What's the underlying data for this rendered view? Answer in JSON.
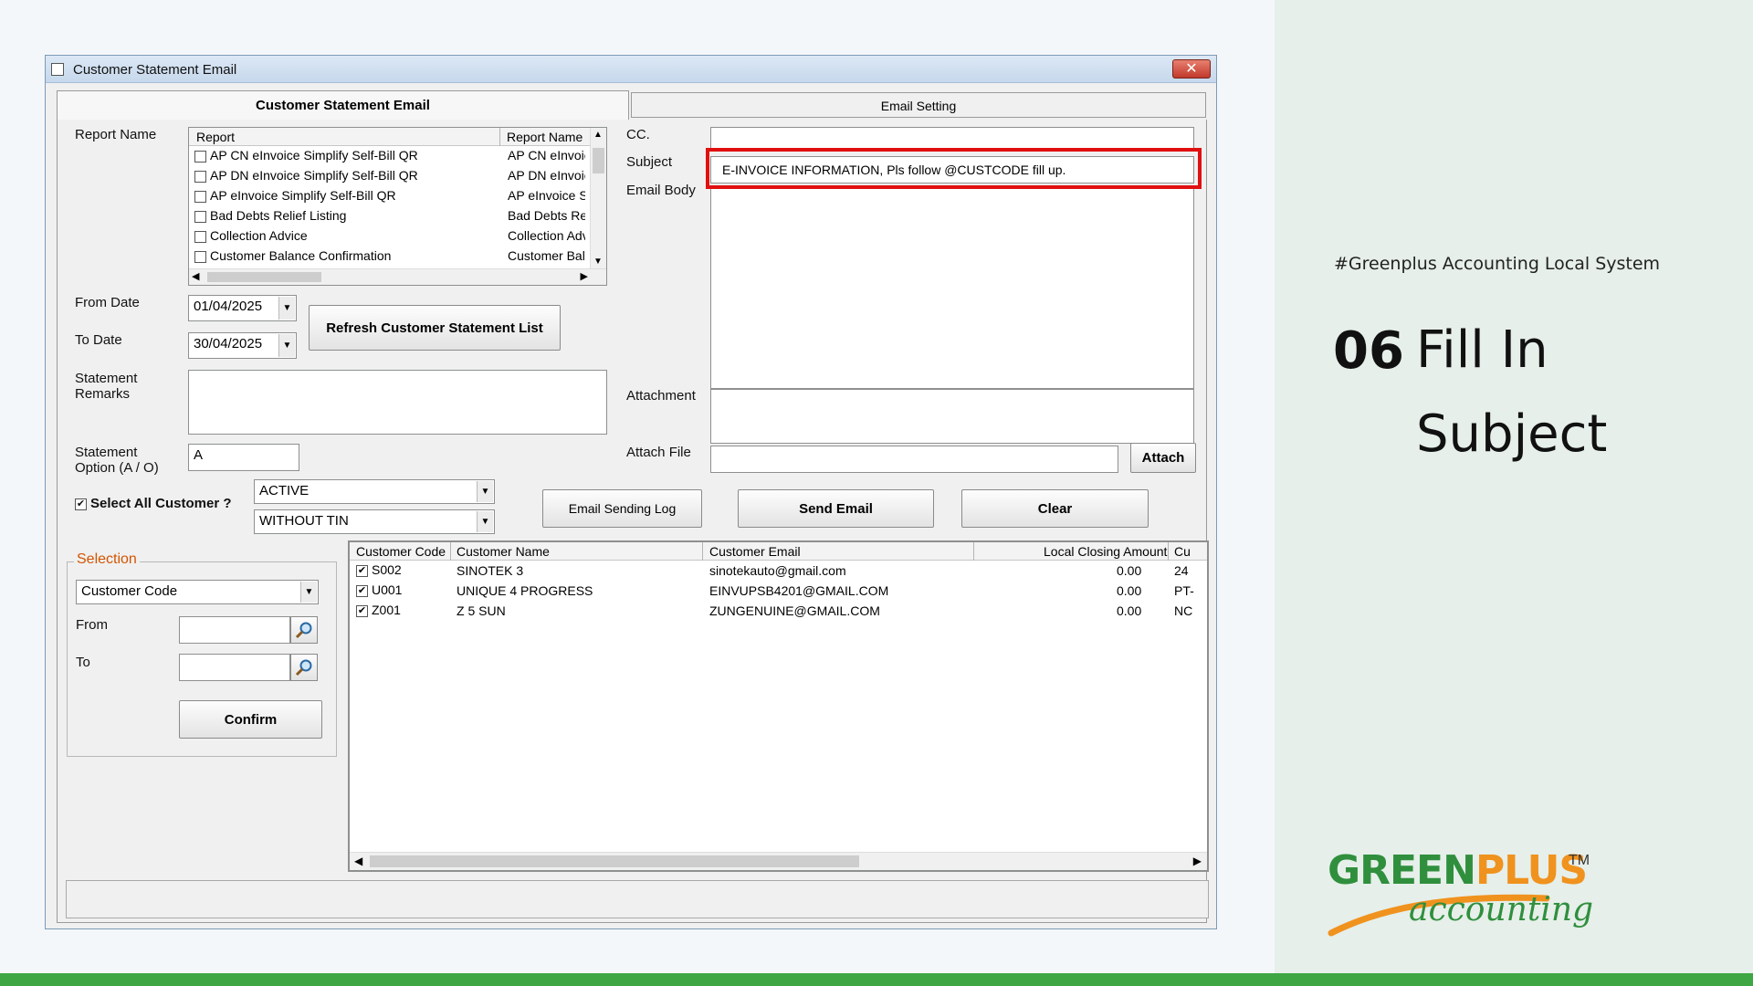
{
  "window": {
    "title": "Customer Statement Email",
    "close_label": "✕"
  },
  "tabs": {
    "active": "Customer Statement Email",
    "inactive": "Email Setting"
  },
  "left": {
    "report_name_label": "Report Name",
    "report_list": {
      "col_report": "Report",
      "col_report_name": "Report Name",
      "rows": [
        {
          "report": "AP CN eInvoice Simplify Self-Bill QR",
          "name": "AP CN eInvoic"
        },
        {
          "report": "AP DN eInvoice Simplify Self-Bill QR",
          "name": "AP DN eInvoic"
        },
        {
          "report": "AP eInvoice Simplify Self-Bill QR",
          "name": "AP eInvoice S"
        },
        {
          "report": "Bad Debts Relief Listing",
          "name": "Bad Debts Re"
        },
        {
          "report": "Collection Advice",
          "name": "Collection Adv"
        },
        {
          "report": "Customer Balance Confirmation",
          "name": "Customer Bal"
        }
      ]
    },
    "from_date_label": "From Date",
    "from_date": "01/04/2025",
    "to_date_label": "To Date",
    "to_date": "30/04/2025",
    "refresh_button": "Refresh Customer Statement List",
    "statement_remarks_label_1": "Statement",
    "statement_remarks_label_2": "Remarks",
    "statement_remarks": "",
    "statement_option_label_1": "Statement",
    "statement_option_label_2": "Option (A / O)",
    "statement_option": "A",
    "select_all_label": "Select All Customer ?",
    "select_all_checked": "✔",
    "status_filter": "ACTIVE",
    "tin_filter": "WITHOUT TIN",
    "selection_title": "Selection",
    "selection_field": "Customer Code",
    "from_label": "From",
    "to_label": "To",
    "from_value": "",
    "to_value": "",
    "confirm_button": "Confirm"
  },
  "right": {
    "cc_label": "CC.",
    "cc_value": "",
    "subject_label": "Subject",
    "subject_value": "E-INVOICE INFORMATION, Pls follow @CUSTCODE fill up.",
    "email_body_label": "Email Body",
    "email_body": "",
    "attachment_label": "Attachment",
    "attach_file_label": "Attach File",
    "attach_file_value": "",
    "attach_button": "Attach",
    "email_log_button": "Email Sending Log",
    "send_button": "Send Email",
    "clear_button": "Clear"
  },
  "grid": {
    "columns": [
      "Customer Code",
      "Customer Name",
      "Customer Email",
      "Local Closing Amount",
      "Cu"
    ],
    "rows": [
      {
        "code": "S002",
        "name": "SINOTEK 3",
        "email": "sinotekauto@gmail.com",
        "amount": "0.00",
        "cu": "24"
      },
      {
        "code": "U001",
        "name": "UNIQUE 4 PROGRESS",
        "email": "EINVUPSB4201@GMAIL.COM",
        "amount": "0.00",
        "cu": "PT-"
      },
      {
        "code": "Z001",
        "name": "Z 5 SUN",
        "email": "ZUNGENUINE@GMAIL.COM",
        "amount": "0.00",
        "cu": "NC"
      }
    ]
  },
  "side": {
    "hashtag": "#Greenplus Accounting Local System",
    "step_number": "06",
    "step_title_1": "Fill In",
    "step_title_2": "Subject",
    "logo_green": "GREEN",
    "logo_plus": "PLUS",
    "logo_tm": "TM",
    "logo_accounting": "accounting"
  },
  "colors": {
    "highlight": "#e01010",
    "brand_green": "#2f8f3d",
    "brand_orange": "#f0921e",
    "bottom_bar": "#3ea744"
  }
}
